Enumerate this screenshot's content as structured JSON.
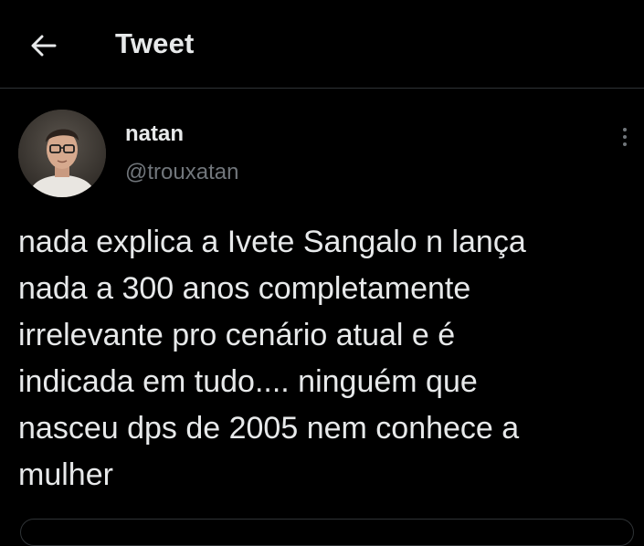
{
  "header": {
    "title": "Tweet",
    "back_icon": "arrow-left-icon"
  },
  "tweet": {
    "author": {
      "display_name": "natan",
      "handle": "@trouxatan"
    },
    "more_icon": "more-vertical-icon",
    "text": "nada explica a Ivete Sangalo n lança\nnada a 300 anos completamente\nirrelevante pro cenário atual e é\nindicada em tudo.... ninguém que\nnasceu dps de 2005 nem conhece a\nmulher"
  },
  "colors": {
    "background": "#000000",
    "primary_text": "#e7e9ea",
    "secondary_text": "#71767b",
    "divider": "#2f3336"
  }
}
